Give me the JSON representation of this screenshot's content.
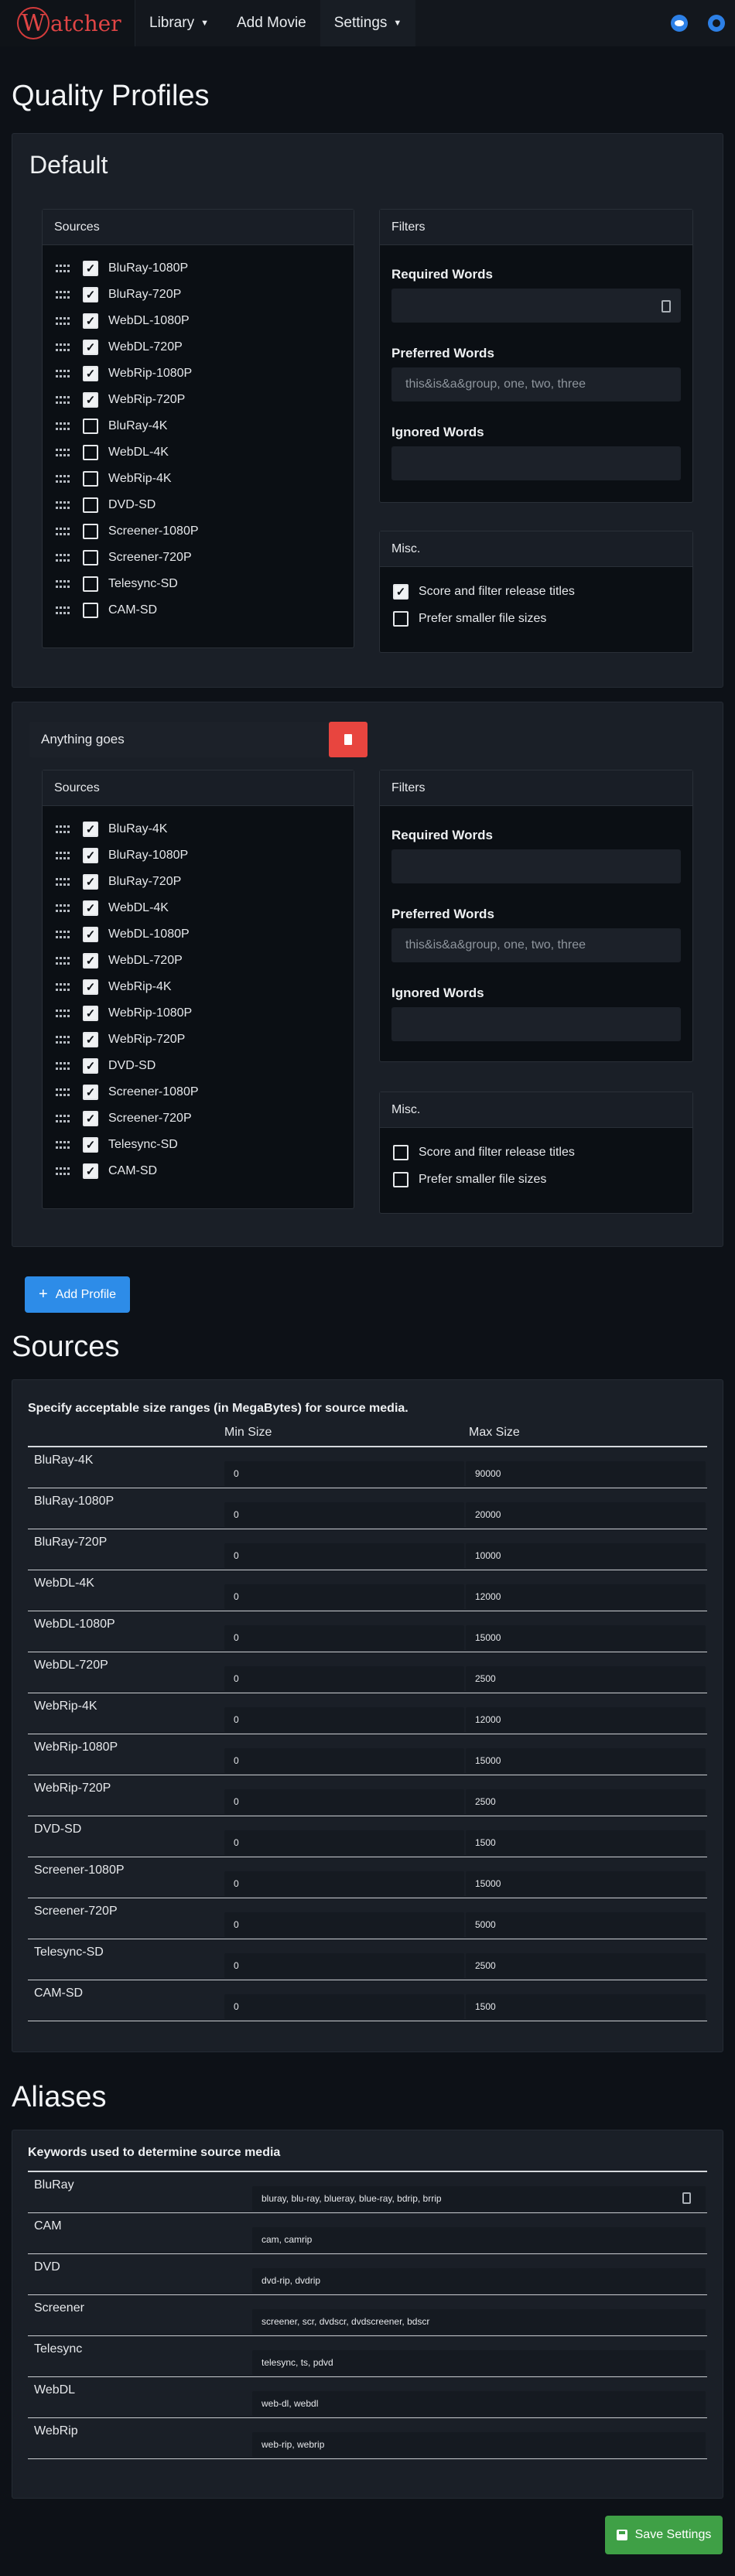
{
  "nav": {
    "brand_initial": "W",
    "brand_rest": "atcher",
    "library": "Library",
    "add_movie": "Add Movie",
    "settings": "Settings",
    "reddit_icon": "reddit-icon",
    "github_icon": "github-icon"
  },
  "quality_profiles": {
    "title": "Quality Profiles",
    "profiles": [
      {
        "name": "Default",
        "sources_header": "Sources",
        "sources": [
          {
            "label": "BluRay-1080P",
            "checked": true
          },
          {
            "label": "BluRay-720P",
            "checked": true
          },
          {
            "label": "WebDL-1080P",
            "checked": true
          },
          {
            "label": "WebDL-720P",
            "checked": true
          },
          {
            "label": "WebRip-1080P",
            "checked": true
          },
          {
            "label": "WebRip-720P",
            "checked": true
          },
          {
            "label": "BluRay-4K",
            "checked": false
          },
          {
            "label": "WebDL-4K",
            "checked": false
          },
          {
            "label": "WebRip-4K",
            "checked": false
          },
          {
            "label": "DVD-SD",
            "checked": false
          },
          {
            "label": "Screener-1080P",
            "checked": false
          },
          {
            "label": "Screener-720P",
            "checked": false
          },
          {
            "label": "Telesync-SD",
            "checked": false
          },
          {
            "label": "CAM-SD",
            "checked": false
          }
        ],
        "filters_header": "Filters",
        "required_label": "Required Words",
        "required_value": "",
        "preferred_label": "Preferred Words",
        "preferred_placeholder": "this&is&a&group, one, two, three",
        "ignored_label": "Ignored Words",
        "ignored_value": "",
        "misc_header": "Misc.",
        "misc": [
          {
            "label": "Score and filter release titles",
            "checked": true
          },
          {
            "label": "Prefer smaller file sizes",
            "checked": false
          }
        ]
      },
      {
        "name": "Anything goes",
        "sources_header": "Sources",
        "sources": [
          {
            "label": "BluRay-4K",
            "checked": true
          },
          {
            "label": "BluRay-1080P",
            "checked": true
          },
          {
            "label": "BluRay-720P",
            "checked": true
          },
          {
            "label": "WebDL-4K",
            "checked": true
          },
          {
            "label": "WebDL-1080P",
            "checked": true
          },
          {
            "label": "WebDL-720P",
            "checked": true
          },
          {
            "label": "WebRip-4K",
            "checked": true
          },
          {
            "label": "WebRip-1080P",
            "checked": true
          },
          {
            "label": "WebRip-720P",
            "checked": true
          },
          {
            "label": "DVD-SD",
            "checked": true
          },
          {
            "label": "Screener-1080P",
            "checked": true
          },
          {
            "label": "Screener-720P",
            "checked": true
          },
          {
            "label": "Telesync-SD",
            "checked": true
          },
          {
            "label": "CAM-SD",
            "checked": true
          }
        ],
        "filters_header": "Filters",
        "required_label": "Required Words",
        "required_value": "",
        "preferred_label": "Preferred Words",
        "preferred_placeholder": "this&is&a&group, one, two, three",
        "ignored_label": "Ignored Words",
        "ignored_value": "",
        "misc_header": "Misc.",
        "misc": [
          {
            "label": "Score and filter release titles",
            "checked": false
          },
          {
            "label": "Prefer smaller file sizes",
            "checked": false
          }
        ]
      }
    ],
    "add_profile": "Add Profile"
  },
  "sources": {
    "title": "Sources",
    "description": "Specify acceptable size ranges (in MegaBytes) for source media.",
    "min_header": "Min Size",
    "max_header": "Max Size",
    "rows": [
      {
        "label": "BluRay-4K",
        "min": "0",
        "max": "90000"
      },
      {
        "label": "BluRay-1080P",
        "min": "0",
        "max": "20000"
      },
      {
        "label": "BluRay-720P",
        "min": "0",
        "max": "10000"
      },
      {
        "label": "WebDL-4K",
        "min": "0",
        "max": "12000"
      },
      {
        "label": "WebDL-1080P",
        "min": "0",
        "max": "15000"
      },
      {
        "label": "WebDL-720P",
        "min": "0",
        "max": "2500"
      },
      {
        "label": "WebRip-4K",
        "min": "0",
        "max": "12000"
      },
      {
        "label": "WebRip-1080P",
        "min": "0",
        "max": "15000"
      },
      {
        "label": "WebRip-720P",
        "min": "0",
        "max": "2500"
      },
      {
        "label": "DVD-SD",
        "min": "0",
        "max": "1500"
      },
      {
        "label": "Screener-1080P",
        "min": "0",
        "max": "15000"
      },
      {
        "label": "Screener-720P",
        "min": "0",
        "max": "5000"
      },
      {
        "label": "Telesync-SD",
        "min": "0",
        "max": "2500"
      },
      {
        "label": "CAM-SD",
        "min": "0",
        "max": "1500"
      }
    ]
  },
  "aliases": {
    "title": "Aliases",
    "description": "Keywords used to determine source media",
    "rows": [
      {
        "label": "BluRay",
        "value": "bluray, blu-ray, blueray, blue-ray, bdrip, brrip"
      },
      {
        "label": "CAM",
        "value": "cam, camrip"
      },
      {
        "label": "DVD",
        "value": "dvd-rip, dvdrip"
      },
      {
        "label": "Screener",
        "value": "screener, scr, dvdscr, dvdscreener, bdscr"
      },
      {
        "label": "Telesync",
        "value": "telesync, ts, pdvd"
      },
      {
        "label": "WebDL",
        "value": "web-dl, webdl"
      },
      {
        "label": "WebRip",
        "value": "web-rip, webrip"
      }
    ]
  },
  "save_button": "Save Settings",
  "colors": {
    "accent_blue": "#2d8ce8",
    "danger_red": "#e8453f",
    "success_green": "#3fa046",
    "brand_red": "#e04545"
  }
}
